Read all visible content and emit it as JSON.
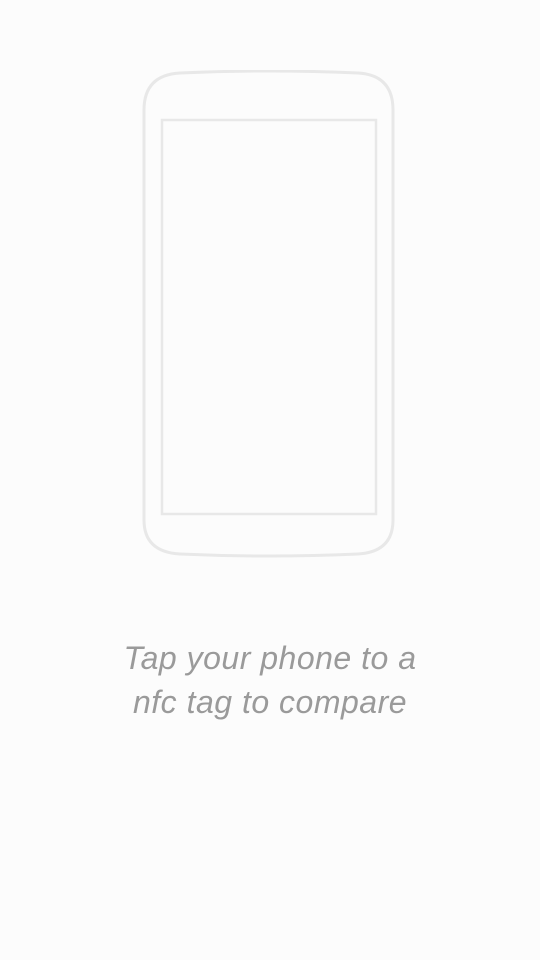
{
  "illustration": {
    "icon": "phone-outline-icon",
    "stroke_color": "#e8e8e8"
  },
  "prompt": {
    "line1": "Tap your phone to a",
    "line2": "nfc tag to compare",
    "color": "#9a9a9a"
  }
}
